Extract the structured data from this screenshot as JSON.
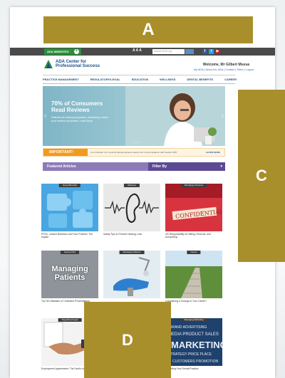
{
  "utility_bar": {
    "ada_websites": "ADA WEBSITES",
    "text_size": "A A A",
    "search_placeholder": "Search ADA.org"
  },
  "header": {
    "logo_line1": "ADA Center for",
    "logo_line2": "Professional Success",
    "welcome": "Welcome, Mr Gilbert Mussa",
    "links": "My ADA  |  About the ADA  |  Contact  |  Store  |  Logout"
  },
  "nav": [
    "PRACTICE MANAGEMENT",
    "REGULATORY/LEGAL",
    "EDUCATION",
    "WELLNESS",
    "DENTAL BENEFITS",
    "CAREER"
  ],
  "hero": {
    "headline": "70% of Consumers Read Reviews",
    "body": "Patients are seeking physicians, scheduling, review your reviews and protect. Learn More."
  },
  "important": {
    "tag": "IMPORTANT!",
    "message": "As of October 16, a second dental practices need to be in full compliance with Section 1557",
    "more": "LEARN MORE"
  },
  "featured": {
    "title": "Featured Articles",
    "filter": "Filter By"
  },
  "articles": [
    {
      "label": "Dental Benefits",
      "caption": "PPOs, Leased Networks and Your Practice: The Impact"
    },
    {
      "label": "Wellness",
      "caption": "Safety Tips to Prevent Hearing Loss"
    },
    {
      "label": "Managing Finances",
      "caption": "3% Responsibility for Billing, Records, and Accounting"
    },
    {
      "label": "Spring 2014",
      "caption": "Top Ten Mistakes of Treatment Presentations",
      "overlay": "Managing Patients"
    },
    {
      "label": "Managing Patients",
      "caption": ""
    },
    {
      "label": "Career",
      "caption": "Considering a Change in Your Career?"
    },
    {
      "label": "Regulatory/Legal",
      "caption": "Employment Agreements: The Devil's in the Details"
    },
    {
      "label": "Managing Marketing",
      "caption": "Marketing Your Dental Practice"
    }
  ],
  "annotations": {
    "a": "A",
    "c": "C",
    "d": "D"
  },
  "colors": {
    "annotation": "#a98f2c",
    "nav_blue": "#1b4f8a",
    "important_orange": "#f29a1f",
    "featured_purple": "#8c7bb8"
  }
}
